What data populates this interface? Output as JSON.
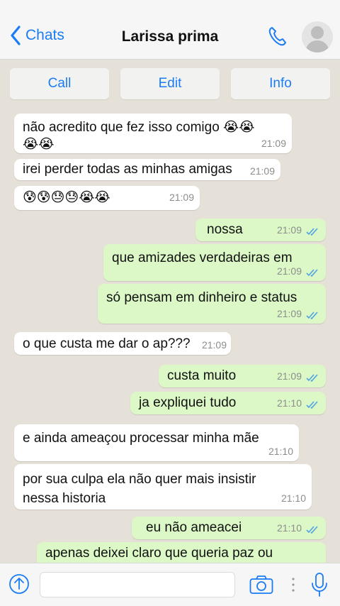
{
  "header": {
    "back_label": "Chats",
    "contact_name": "Larissa prima"
  },
  "actions": {
    "call": "Call",
    "edit": "Edit",
    "info": "Info"
  },
  "messages": [
    {
      "dir": "in",
      "text": "não acredito que fez isso comigo 😭😭",
      "text2": "😭😭",
      "time": "21:09"
    },
    {
      "dir": "in",
      "text": "irei perder todas as minhas amigas",
      "time": "21:09"
    },
    {
      "dir": "in",
      "text": "😰😰😓😓😭😭",
      "time": "21:09"
    },
    {
      "dir": "out",
      "text": "nossa",
      "time": "21:09"
    },
    {
      "dir": "out",
      "text": "que amizades verdadeiras em",
      "time": "21:09"
    },
    {
      "dir": "out",
      "text": "só pensam em dinheiro e status",
      "time": "21:09"
    },
    {
      "dir": "in",
      "text": "o que custa me dar o ap???",
      "time": "21:09"
    },
    {
      "dir": "out",
      "text": "custa muito",
      "time": "21:09"
    },
    {
      "dir": "out",
      "text": "ja expliquei tudo",
      "time": "21:10"
    },
    {
      "dir": "in",
      "text": "e ainda ameaçou processar minha mãe",
      "time": "21:10"
    },
    {
      "dir": "in",
      "text": "por sua culpa ela não quer mais insistir",
      "text2": "nessa historia",
      "time": "21:10"
    },
    {
      "dir": "out",
      "text": "eu não ameacei",
      "time": "21:10"
    },
    {
      "dir": "out",
      "text": "apenas deixei claro que queria paz ou",
      "time": ""
    }
  ],
  "colors": {
    "accent": "#1a7cf4",
    "outgoing": "#dcf8c6",
    "incoming": "#ffffff",
    "background": "#e6e1d8",
    "read_ticks": "#4fa3e3"
  },
  "icons": [
    "back-chevron-icon",
    "phone-icon",
    "avatar-icon",
    "upload-icon",
    "camera-icon",
    "more-dots-icon",
    "microphone-icon",
    "read-ticks-icon"
  ]
}
